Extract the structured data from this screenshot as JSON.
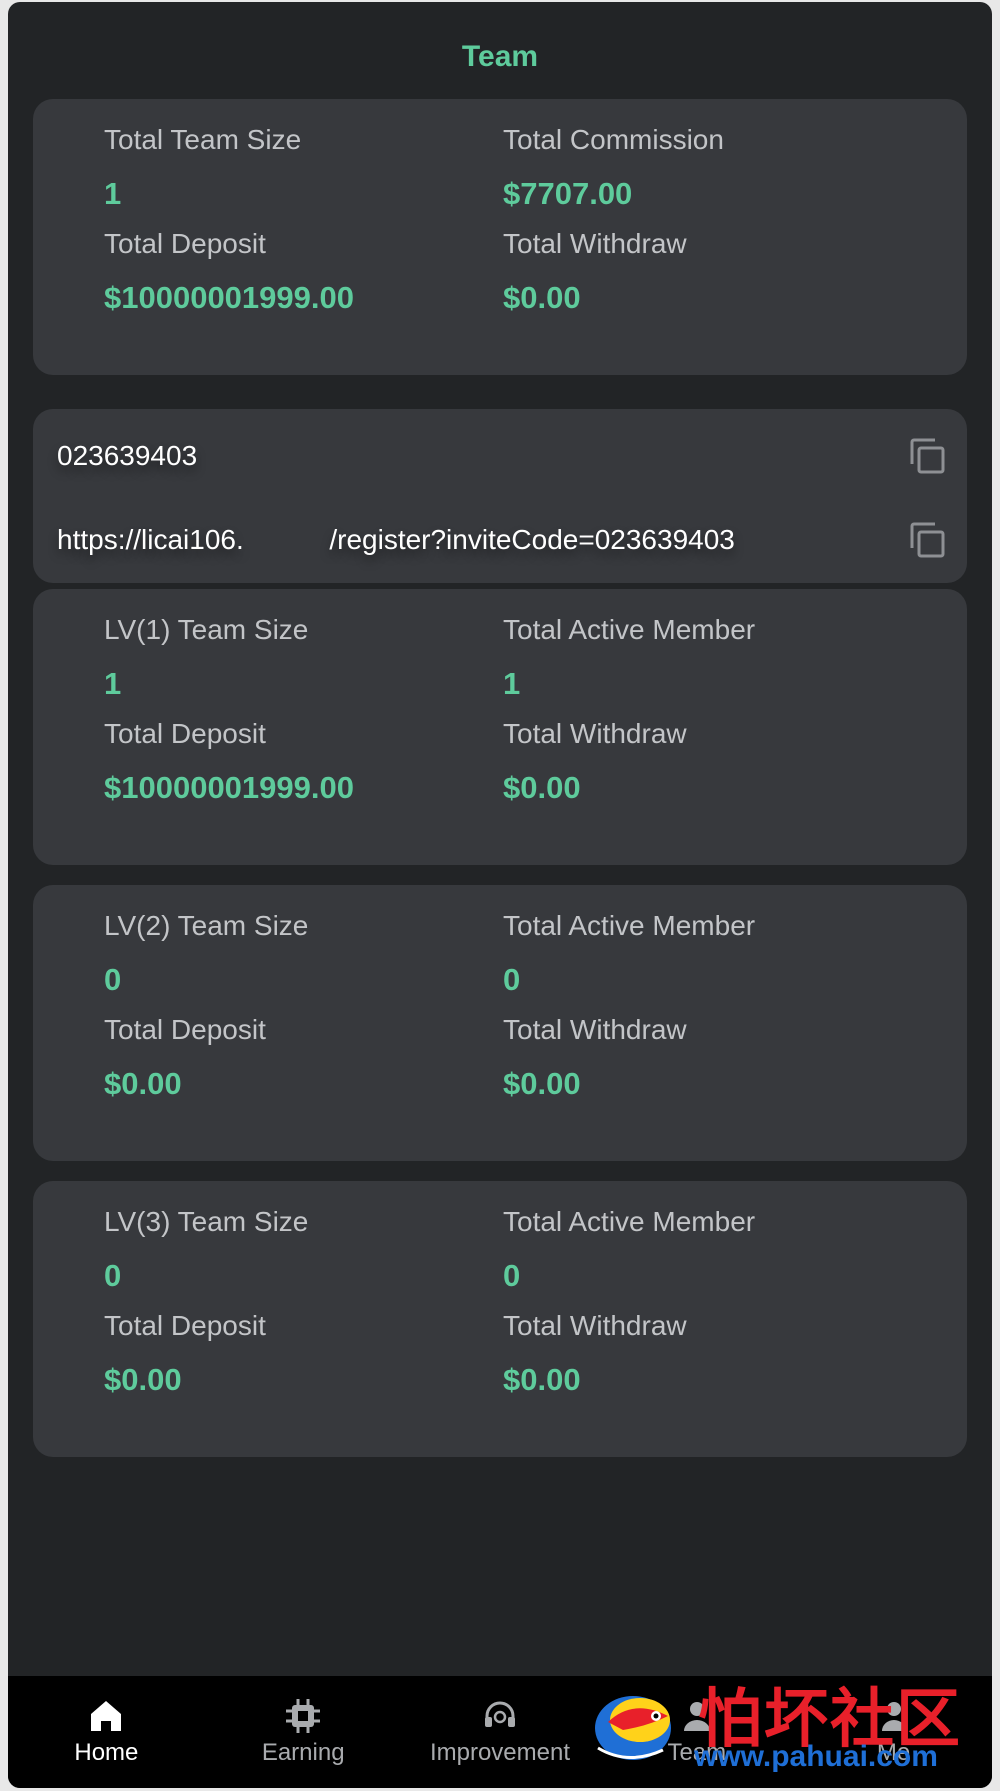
{
  "header": {
    "title": "Team"
  },
  "summary": {
    "team_size_label": "Total Team Size",
    "team_size_value": "1",
    "commission_label": "Total Commission",
    "commission_value": "$7707.00",
    "deposit_label": "Total Deposit",
    "deposit_value": "$10000001999.00",
    "withdraw_label": "Total Withdraw",
    "withdraw_value": "$0.00"
  },
  "invite": {
    "code": "023639403",
    "link": "https://licai106.           /register?inviteCode=023639403"
  },
  "levels": [
    {
      "size_label": "LV(1) Team Size",
      "size_value": "1",
      "active_label": "Total Active Member",
      "active_value": "1",
      "deposit_label": "Total Deposit",
      "deposit_value": "$10000001999.00",
      "withdraw_label": "Total Withdraw",
      "withdraw_value": "$0.00"
    },
    {
      "size_label": "LV(2) Team Size",
      "size_value": "0",
      "active_label": "Total Active Member",
      "active_value": "0",
      "deposit_label": "Total Deposit",
      "deposit_value": "$0.00",
      "withdraw_label": "Total Withdraw",
      "withdraw_value": "$0.00"
    },
    {
      "size_label": "LV(3) Team Size",
      "size_value": "0",
      "active_label": "Total Active Member",
      "active_value": "0",
      "deposit_label": "Total Deposit",
      "deposit_value": "$0.00",
      "withdraw_label": "Total Withdraw",
      "withdraw_value": "$0.00"
    }
  ],
  "nav": [
    {
      "label": "Home",
      "icon": "home-icon",
      "active": true
    },
    {
      "label": "Earning",
      "icon": "chip-icon",
      "active": false
    },
    {
      "label": "Improvement",
      "icon": "headset-icon",
      "active": false
    },
    {
      "label": "Team",
      "icon": "team-icon",
      "active": false
    },
    {
      "label": "Me",
      "icon": "user-icon",
      "active": false
    }
  ],
  "watermark": {
    "cn_text": "怕坏社区",
    "url": "www.pahuai.com"
  },
  "colors": {
    "accent": "#5ecb9c",
    "background": "#222426",
    "card": "#37393d",
    "nav_bg": "#000000"
  }
}
